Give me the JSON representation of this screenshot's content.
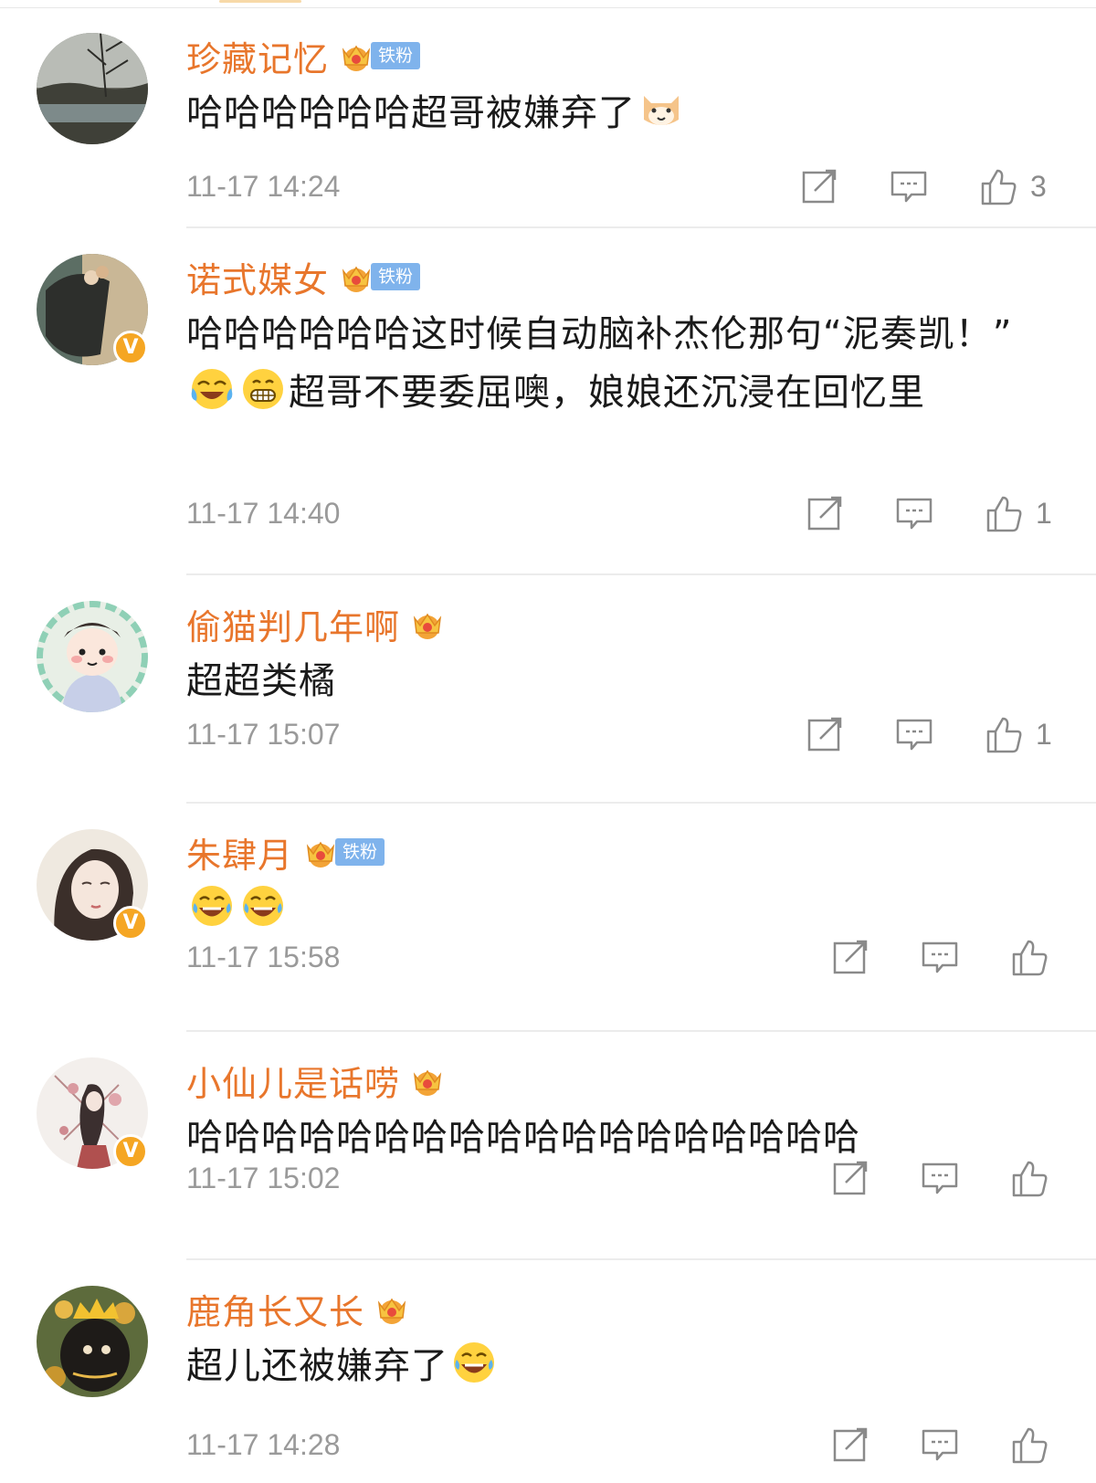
{
  "comments": [
    {
      "username": "珍藏记忆",
      "fan_badge": "铁粉",
      "verified": false,
      "text": "哈哈哈哈哈哈超哥被嫌弃了",
      "emojis": [
        "cat-face-emoji"
      ],
      "time": "11-17 14:24",
      "likes": "3"
    },
    {
      "username": "诺式媒女",
      "fan_badge": "铁粉",
      "verified": true,
      "text_a": "哈哈哈哈哈哈这时候自动脑补杰伦那句“泥奏凯！”",
      "text_b": "超哥不要委屈噢，娘娘还沉浸在回忆里",
      "emojis": [
        "laughing-crying-emoji",
        "grinning-emoji"
      ],
      "time": "11-17 14:40",
      "likes": "1"
    },
    {
      "username": "偷猫判几年啊",
      "fan_badge": "",
      "verified": false,
      "text": "超超类橘",
      "time": "11-17 15:07",
      "likes": "1"
    },
    {
      "username": "朱肆月",
      "fan_badge": "铁粉",
      "verified": true,
      "text": "",
      "emojis": [
        "tears-of-joy-emoji",
        "tears-of-joy-emoji"
      ],
      "time": "11-17 15:58",
      "likes": ""
    },
    {
      "username": "小仙儿是话唠",
      "fan_badge": "",
      "verified": true,
      "text": "哈哈哈哈哈哈哈哈哈哈哈哈哈哈哈哈哈哈",
      "time": "11-17 15:02",
      "likes": ""
    },
    {
      "username": "鹿角长又长",
      "fan_badge": "",
      "verified": false,
      "text": "超儿还被嫌弃了",
      "emojis": [
        "tears-of-joy-emoji"
      ],
      "time": "11-17 14:28",
      "likes": ""
    }
  ],
  "colors": {
    "username": "#e8762c",
    "fan_badge_bg": "#7fb3ec",
    "verified_badge": "#f5a623",
    "meta_gray": "#9a9a9a"
  },
  "icons": [
    "share-icon",
    "comment-icon",
    "like-icon",
    "crown-icon"
  ]
}
